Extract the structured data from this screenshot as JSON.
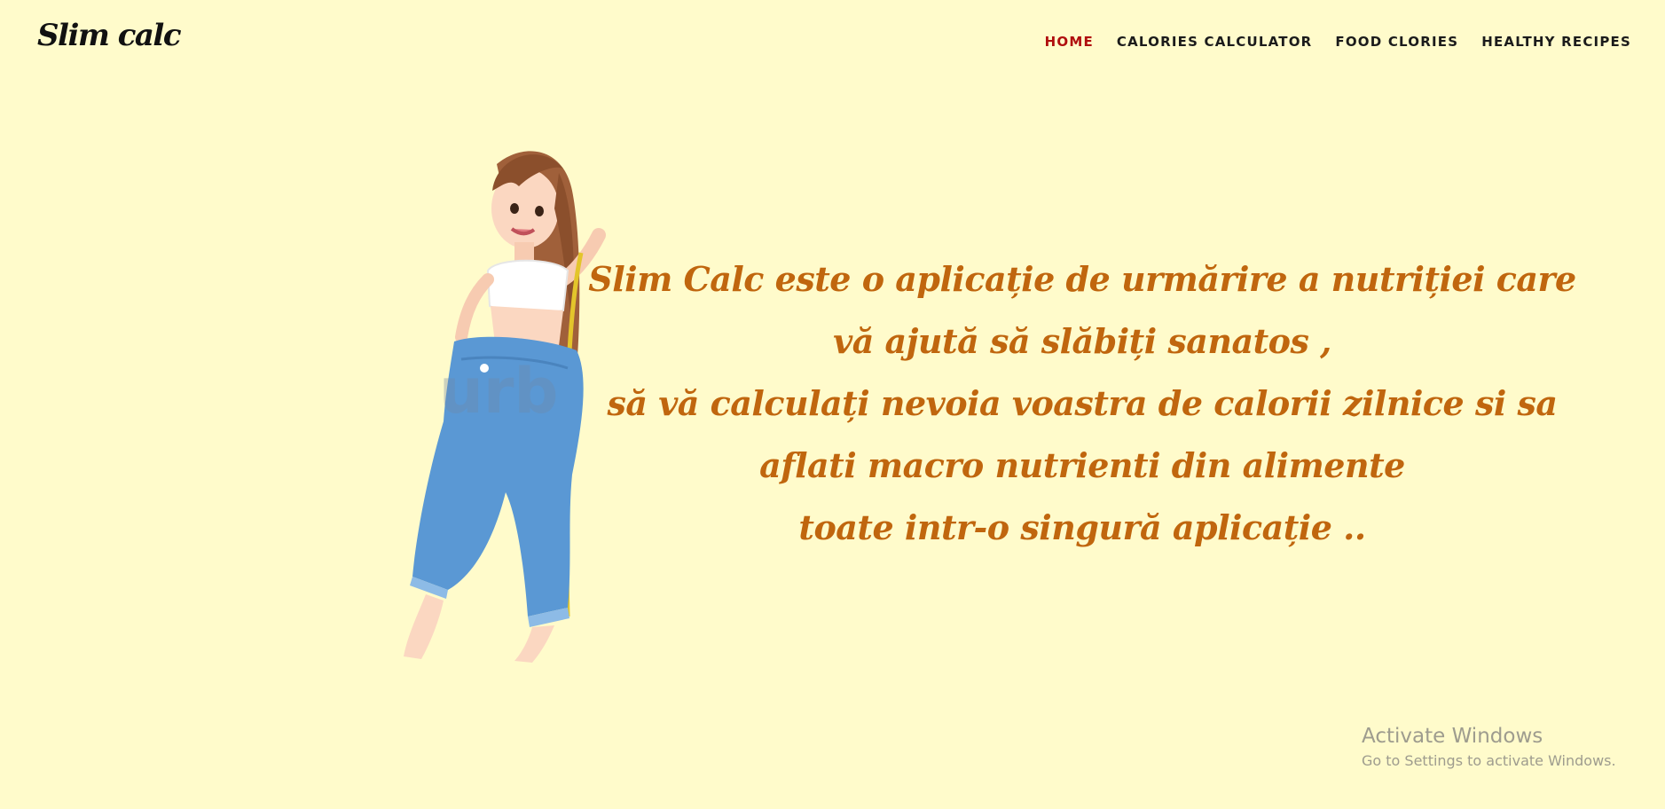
{
  "header": {
    "logo": "Slim calc",
    "nav": [
      {
        "label": "HOME",
        "active": true
      },
      {
        "label": "CALORIES CALCULATOR",
        "active": false
      },
      {
        "label": "FOOD CLORIES",
        "active": false
      },
      {
        "label": "HEALTHY RECIPES",
        "active": false
      }
    ]
  },
  "hero": {
    "lines": [
      "Slim Calc este o aplicație de urmărire a nutriției care",
      "vă ajută să slăbiți sanatos ,",
      "să vă calculați nevoia voastra de calorii zilnice si sa",
      "aflati macro nutrienti din alimente",
      "toate intr-o singură aplicație .."
    ],
    "illustration_icon": "weight-loss-woman-illustration",
    "illustration_overlay_text": "urb"
  },
  "watermark": {
    "title": "Activate Windows",
    "subtitle": "Go to Settings to activate Windows."
  },
  "colors": {
    "background": "#fffbcb",
    "accent_text": "#c0660e",
    "nav_active": "#b00e0e",
    "nav_default": "#1b1b1b"
  }
}
